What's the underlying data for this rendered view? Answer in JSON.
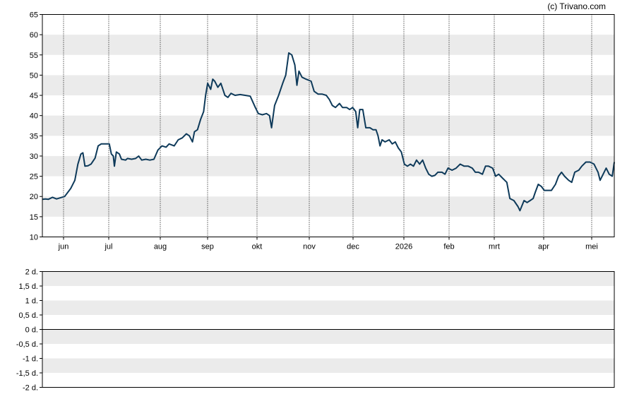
{
  "credit": "(c) Trivano.com",
  "chart_data": [
    {
      "type": "line",
      "x_ticks": [
        "jun",
        "jul",
        "aug",
        "sep",
        "okt",
        "nov",
        "dec",
        "2026",
        "feb",
        "mrt",
        "apr",
        "mei"
      ],
      "y_ticks": [
        "10",
        "15",
        "20",
        "25",
        "30",
        "35",
        "40",
        "45",
        "50",
        "55",
        "60",
        "65"
      ],
      "ylim": [
        10,
        65
      ],
      "grid": "alternating horizontal bands, dotted vertical month lines",
      "series": [
        {
          "color": "#0e3a5a",
          "points": [
            [
              0,
              19.3
            ],
            [
              0.3,
              19.4
            ],
            [
              0.6,
              19.3
            ],
            [
              1.0,
              19.8
            ],
            [
              1.4,
              19.4
            ],
            [
              1.8,
              19.7
            ],
            [
              2.2,
              20.0
            ],
            [
              2.5,
              21.0
            ],
            [
              2.8,
              22.0
            ],
            [
              3.2,
              24.0
            ],
            [
              3.5,
              28.0
            ],
            [
              3.8,
              30.5
            ],
            [
              4.0,
              30.8
            ],
            [
              4.2,
              27.5
            ],
            [
              4.5,
              27.6
            ],
            [
              4.8,
              28.0
            ],
            [
              5.2,
              29.5
            ],
            [
              5.5,
              32.5
            ],
            [
              5.8,
              33.0
            ],
            [
              6.2,
              33.0
            ],
            [
              6.6,
              33.0
            ],
            [
              6.8,
              30.5
            ],
            [
              7.0,
              30.0
            ],
            [
              7.1,
              27.5
            ],
            [
              7.3,
              31.0
            ],
            [
              7.6,
              30.5
            ],
            [
              7.8,
              29.2
            ],
            [
              8.2,
              29.0
            ],
            [
              8.4,
              29.4
            ],
            [
              8.8,
              29.2
            ],
            [
              9.2,
              29.4
            ],
            [
              9.5,
              30.0
            ],
            [
              9.8,
              29.0
            ],
            [
              10.2,
              29.2
            ],
            [
              10.6,
              29.0
            ],
            [
              11.0,
              29.2
            ],
            [
              11.4,
              31.5
            ],
            [
              11.8,
              32.5
            ],
            [
              12.2,
              32.2
            ],
            [
              12.5,
              33.0
            ],
            [
              13.0,
              32.5
            ],
            [
              13.4,
              34.0
            ],
            [
              13.8,
              34.5
            ],
            [
              14.2,
              35.5
            ],
            [
              14.5,
              35.0
            ],
            [
              14.8,
              33.5
            ],
            [
              15.0,
              36.0
            ],
            [
              15.3,
              36.5
            ],
            [
              15.6,
              39.0
            ],
            [
              15.9,
              41.0
            ],
            [
              16.1,
              45.0
            ],
            [
              16.3,
              48.0
            ],
            [
              16.6,
              46.5
            ],
            [
              16.8,
              49.0
            ],
            [
              17.0,
              48.5
            ],
            [
              17.3,
              47.0
            ],
            [
              17.6,
              48.0
            ],
            [
              18.0,
              45.0
            ],
            [
              18.3,
              44.5
            ],
            [
              18.6,
              45.5
            ],
            [
              19.0,
              45.0
            ],
            [
              19.5,
              45.2
            ],
            [
              20.0,
              45.0
            ],
            [
              20.5,
              44.8
            ],
            [
              21.0,
              42.0
            ],
            [
              21.3,
              40.5
            ],
            [
              21.7,
              40.2
            ],
            [
              22.1,
              40.5
            ],
            [
              22.4,
              40.0
            ],
            [
              22.6,
              37.0
            ],
            [
              22.9,
              42.5
            ],
            [
              23.3,
              45.0
            ],
            [
              23.7,
              48.0
            ],
            [
              24.0,
              50.0
            ],
            [
              24.3,
              55.5
            ],
            [
              24.6,
              55.0
            ],
            [
              24.9,
              52.5
            ],
            [
              25.1,
              47.5
            ],
            [
              25.3,
              51.0
            ],
            [
              25.6,
              49.5
            ],
            [
              26.0,
              49.0
            ],
            [
              26.5,
              48.5
            ],
            [
              26.8,
              46.0
            ],
            [
              27.2,
              45.3
            ],
            [
              27.6,
              45.3
            ],
            [
              28.0,
              45.0
            ],
            [
              28.3,
              44.0
            ],
            [
              28.6,
              42.5
            ],
            [
              28.9,
              42.0
            ],
            [
              29.3,
              43.0
            ],
            [
              29.6,
              42.0
            ],
            [
              30.0,
              42.0
            ],
            [
              30.3,
              41.5
            ],
            [
              30.6,
              42.0
            ],
            [
              30.9,
              41.0
            ],
            [
              31.1,
              37.0
            ],
            [
              31.3,
              41.5
            ],
            [
              31.6,
              41.5
            ],
            [
              31.9,
              37.0
            ],
            [
              32.3,
              37.0
            ],
            [
              32.6,
              36.5
            ],
            [
              32.9,
              36.5
            ],
            [
              33.1,
              35.0
            ],
            [
              33.3,
              32.5
            ],
            [
              33.5,
              34.0
            ],
            [
              33.8,
              33.5
            ],
            [
              34.2,
              34.0
            ],
            [
              34.5,
              33.0
            ],
            [
              34.8,
              33.5
            ],
            [
              35.1,
              32.0
            ],
            [
              35.4,
              31.0
            ],
            [
              35.7,
              28.0
            ],
            [
              36.0,
              27.5
            ],
            [
              36.3,
              28.0
            ],
            [
              36.6,
              27.5
            ],
            [
              36.9,
              29.0
            ],
            [
              37.2,
              28.0
            ],
            [
              37.5,
              29.0
            ],
            [
              37.8,
              27.0
            ],
            [
              38.1,
              25.5
            ],
            [
              38.4,
              25.0
            ],
            [
              38.7,
              25.2
            ],
            [
              39.0,
              26.0
            ],
            [
              39.4,
              26.0
            ],
            [
              39.7,
              25.5
            ],
            [
              40.0,
              27.0
            ],
            [
              40.4,
              26.5
            ],
            [
              40.8,
              27.0
            ],
            [
              41.2,
              28.0
            ],
            [
              41.6,
              27.5
            ],
            [
              42.0,
              27.5
            ],
            [
              42.4,
              27.0
            ],
            [
              42.7,
              26.0
            ],
            [
              43.0,
              26.0
            ],
            [
              43.4,
              25.5
            ],
            [
              43.7,
              27.5
            ],
            [
              44.0,
              27.5
            ],
            [
              44.4,
              27.0
            ],
            [
              44.7,
              25.0
            ],
            [
              45.0,
              25.5
            ],
            [
              45.4,
              24.5
            ],
            [
              45.8,
              23.5
            ],
            [
              46.1,
              19.5
            ],
            [
              46.5,
              19.0
            ],
            [
              46.9,
              17.5
            ],
            [
              47.1,
              16.5
            ],
            [
              47.5,
              19.0
            ],
            [
              47.8,
              18.5
            ],
            [
              48.1,
              19.0
            ],
            [
              48.4,
              19.5
            ],
            [
              48.6,
              21.0
            ],
            [
              48.9,
              23.0
            ],
            [
              49.2,
              22.5
            ],
            [
              49.5,
              21.5
            ],
            [
              49.9,
              21.5
            ],
            [
              50.2,
              21.5
            ],
            [
              50.6,
              23.0
            ],
            [
              50.9,
              25.0
            ],
            [
              51.2,
              26.0
            ],
            [
              51.5,
              25.0
            ],
            [
              51.9,
              24.0
            ],
            [
              52.2,
              23.5
            ],
            [
              52.5,
              26.0
            ],
            [
              52.9,
              26.5
            ],
            [
              53.2,
              27.5
            ],
            [
              53.6,
              28.5
            ],
            [
              54.0,
              28.5
            ],
            [
              54.4,
              28.0
            ],
            [
              54.8,
              26.0
            ],
            [
              55.0,
              24.0
            ],
            [
              55.3,
              25.5
            ],
            [
              55.6,
              27.0
            ],
            [
              55.9,
              25.5
            ],
            [
              56.2,
              25.0
            ],
            [
              56.4,
              28.5
            ]
          ]
        }
      ]
    },
    {
      "type": "line",
      "y_ticks": [
        "2 d.",
        "1,5 d.",
        "1 d.",
        "0,5 d.",
        "0 d.",
        "-0,5 d.",
        "-1 d.",
        "-1,5 d.",
        "-2 d."
      ],
      "ylim": [
        -2,
        2
      ],
      "grid": "alternating horizontal bands, zero line",
      "series": []
    }
  ]
}
